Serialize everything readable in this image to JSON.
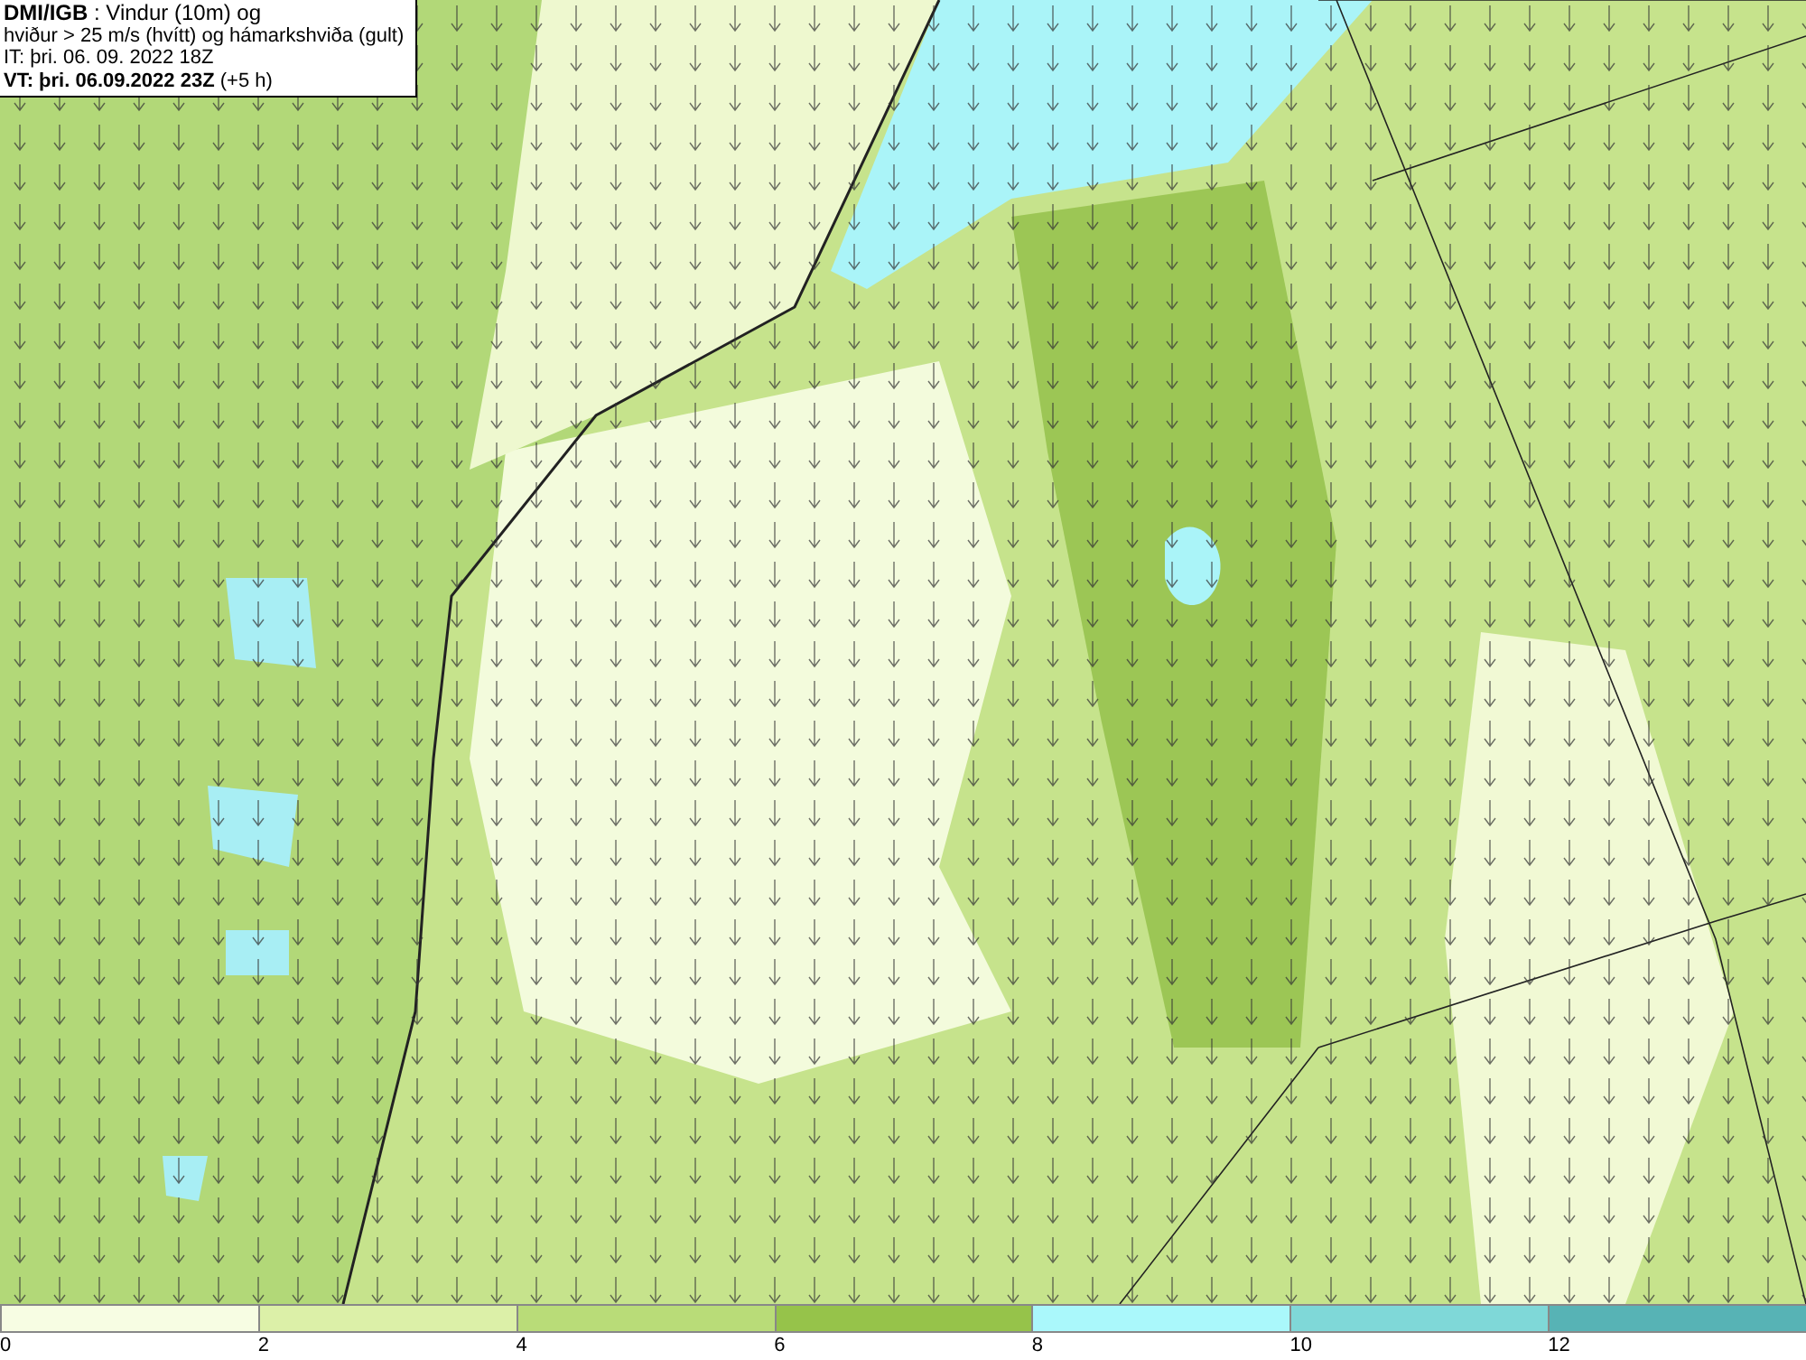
{
  "header": {
    "lines": [
      "**DMI/IGB** : Vindur (10m) og",
      "hviður > 25 m/s (hvítt) og hámarkshviða (gult)",
      "IT: þri. 06. 09. 2022 18Z",
      "**VT: þri. 06.09.2022 23Z** (+5 h)"
    ]
  },
  "legend": {
    "bins": [
      {
        "color": "#f7fde3"
      },
      {
        "color": "#dcf0a8"
      },
      {
        "color": "#b9dc78"
      },
      {
        "color": "#96c34a"
      },
      {
        "color": "#aaf8fb"
      },
      {
        "color": "#7fd8d8"
      },
      {
        "color": "#57b3b5"
      }
    ],
    "ticks": [
      "0",
      "2",
      "4",
      "6",
      "8",
      "10",
      "12"
    ]
  }
}
